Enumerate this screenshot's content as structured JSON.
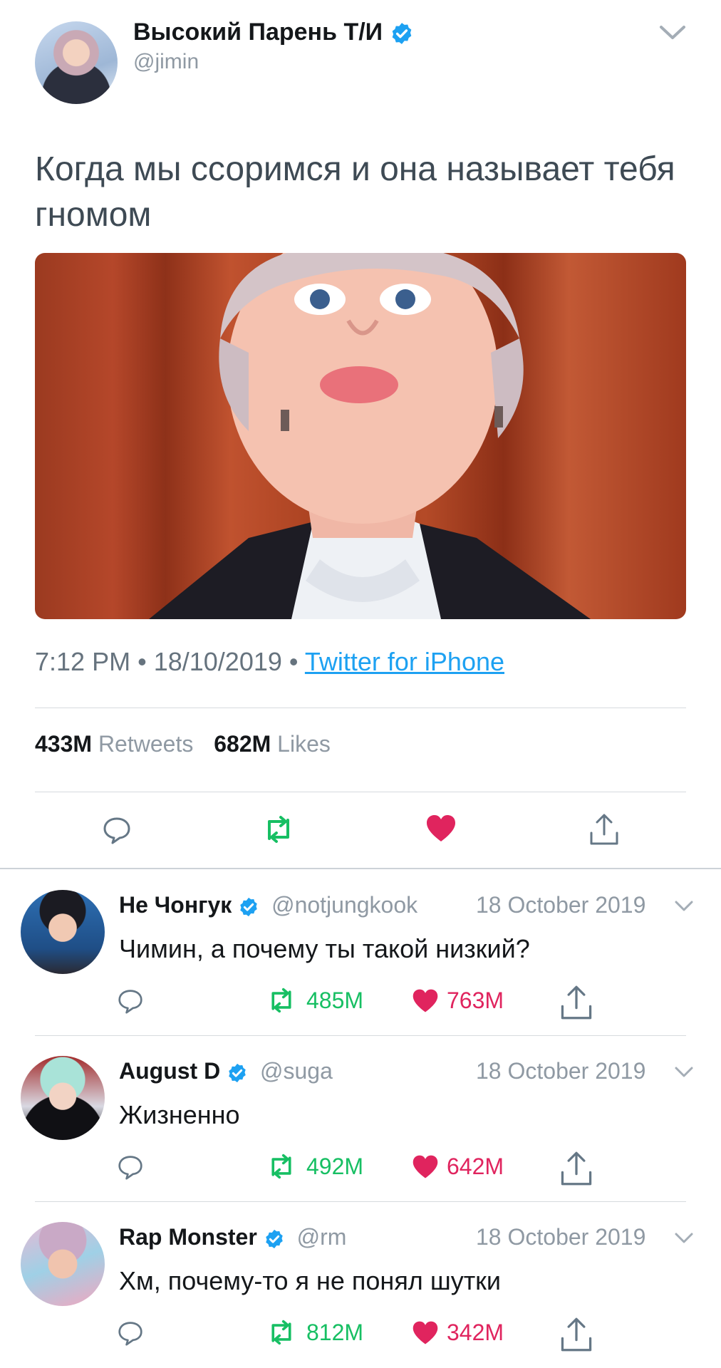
{
  "tweet": {
    "display_name": "Высокий Парень Т/И",
    "handle": "@jimin",
    "text": "Когда мы ссоримся и она называет тебя гномом",
    "time": "7:12 PM",
    "date": "18/10/2019",
    "separator": "•",
    "source": "Twitter for iPhone",
    "retweets_count": "433M",
    "retweets_label": "Retweets",
    "likes_count": "682M",
    "likes_label": "Likes",
    "liked": true
  },
  "icons": {
    "verified": "verified-badge-icon",
    "caret": "chevron-down-icon",
    "reply": "reply-icon",
    "retweet": "retweet-icon",
    "like": "heart-icon",
    "share": "share-icon"
  },
  "colors": {
    "accent": "#1da1f2",
    "retweet_green": "#17bf63",
    "like_red": "#e0245e",
    "muted": "#8f99a3"
  },
  "replies": [
    {
      "name": "Не Чонгук",
      "handle": "@notjungkook",
      "date": "18 October 2019",
      "text": "Чимин, а почему ты такой низкий?",
      "retweets": "485M",
      "likes": "763M"
    },
    {
      "name": "August D",
      "handle": "@suga",
      "date": "18 October 2019",
      "text": "Жизненно",
      "retweets": "492M",
      "likes": "642M"
    },
    {
      "name": "Rap Monster",
      "handle": "@rm",
      "date": "18 October 2019",
      "text": "Хм, почему-то я не понял шутки",
      "retweets": "812M",
      "likes": "342M"
    }
  ]
}
